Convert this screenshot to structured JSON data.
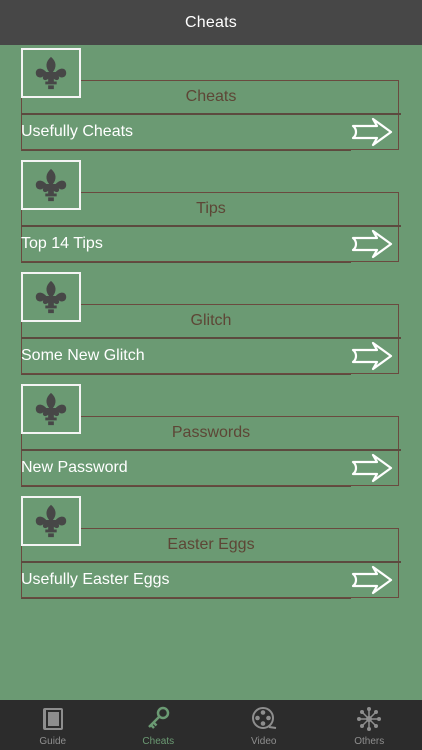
{
  "header": {
    "title": "Cheats"
  },
  "cards": [
    {
      "category": "Cheats",
      "subtitle": "Usefully Cheats",
      "icon": "fleur-de-lis-icon"
    },
    {
      "category": "Tips",
      "subtitle": "Top 14 Tips",
      "icon": "fleur-de-lis-icon"
    },
    {
      "category": "Glitch",
      "subtitle": "Some New Glitch",
      "icon": "fleur-de-lis-icon"
    },
    {
      "category": "Passwords",
      "subtitle": "New Password",
      "icon": "fleur-de-lis-icon"
    },
    {
      "category": "Easter Eggs",
      "subtitle": "Usefully Easter Eggs",
      "icon": "fleur-de-lis-icon"
    }
  ],
  "tabbar": {
    "tabs": [
      {
        "label": "Guide",
        "icon": "book-icon",
        "active": false
      },
      {
        "label": "Cheats",
        "icon": "key-icon",
        "active": true
      },
      {
        "label": "Video",
        "icon": "film-reel-icon",
        "active": false
      },
      {
        "label": "Others",
        "icon": "network-icon",
        "active": false
      }
    ]
  },
  "colors": {
    "background": "#6b9a73",
    "navbar": "#474747",
    "tabbar": "#2c2c2c",
    "category_text": "#5d4636",
    "active_tab": "#6b9a73"
  }
}
